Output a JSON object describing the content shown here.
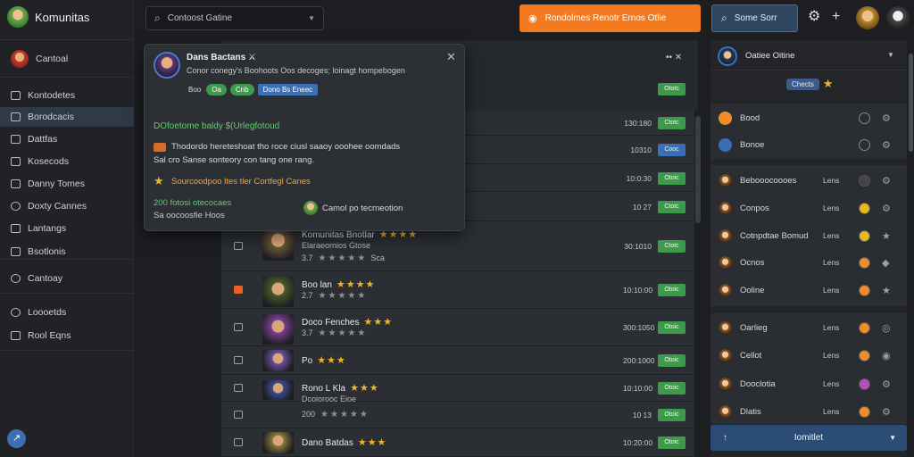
{
  "app": {
    "title": "Komunitas"
  },
  "sidebar": {
    "user_label": "Cantoal",
    "items": [
      {
        "label": "Kontodetes",
        "icon": "house-icon"
      },
      {
        "label": "Borodcacis",
        "icon": "box-icon"
      },
      {
        "label": "Dattfas",
        "icon": "folder-icon"
      },
      {
        "label": "Kosecods",
        "icon": "pin-icon"
      },
      {
        "label": "Danny Tomes",
        "icon": "doc-icon"
      },
      {
        "label": "Doxty Cannes",
        "icon": "circle-icon"
      },
      {
        "label": "Lantangs",
        "icon": "doc-icon"
      },
      {
        "label": "Bsotlonis",
        "icon": "doc-icon"
      },
      {
        "label": "Cantoay",
        "icon": "gear-icon"
      },
      {
        "label": "Loooetds",
        "icon": "circle-icon"
      },
      {
        "label": "Rool Eqns",
        "icon": "tool-icon"
      }
    ]
  },
  "topbar": {
    "search_value": "Contoost Gatine",
    "orange_label": "Rondolmes Renotr Ernos Otlie",
    "blue_label": "Some Sorr"
  },
  "popup": {
    "name": "Dans Bactans",
    "name_suffix": "⚔",
    "desc": "Conor conegy's Boohoots Oos decoges; loinagt hompebogen",
    "chips": [
      "Boo",
      "Oa",
      "Cnb",
      "Dono Bs Eneec"
    ],
    "headline": "DOfoetome baldy $(Urlegfotoud",
    "body_line1": "Thodordo hereteshoat tho roce ciusl saaoy ooohee oomdads",
    "body_line2": "Sal cro Sanse sonteory con tang one rang.",
    "star_line": "Sourcoodpoo ltes tler Cortfegl Canes",
    "green_line": "200 fotosi otecocaes",
    "grey_line": "Sa oocoosfie Hoos",
    "link_label": "Camol po tecrneotion"
  },
  "table": {
    "header_btn": "Ototc",
    "rows": [
      {
        "num": "130:180",
        "btn": "Ctotc",
        "btn_color": "#3e9a4b"
      },
      {
        "num": "10310",
        "btn": "Cooc",
        "btn_color": "#3a6fb5"
      },
      {
        "num": "10:0:30",
        "btn": "Otoic",
        "btn_color": "#3e9a4b"
      },
      {
        "num": "10 27",
        "btn": "Ctotc",
        "btn_color": "#3e9a4b"
      },
      {
        "title": "Komunitas Bnotlar",
        "sub": "Elaraeornios Gtose",
        "rating_text": "3.7",
        "extra": "Sca",
        "num": "30:1010",
        "btn": "Ctotc",
        "btn_color": "#3e9a4b",
        "stars": 4,
        "checked": false
      },
      {
        "title": "Boo lan",
        "sub": "",
        "rating_text": "2.7",
        "num": "10:10:00",
        "btn": "Otoic",
        "btn_color": "#3e9a4b",
        "stars": 4,
        "checked": true
      },
      {
        "title": "Doco Fenches",
        "sub": "",
        "rating_text": "3.7",
        "num": "300:1050",
        "btn": "Otoic",
        "btn_color": "#3e9a4b",
        "stars": 3,
        "checked": false
      },
      {
        "title": "Po",
        "sub": "",
        "rating_text": "",
        "num": "200:1000",
        "btn": "Otoic",
        "btn_color": "#3e9a4b",
        "stars": 3,
        "checked": false
      },
      {
        "title": "Rono L Kla",
        "sub": "Dcoiorooc Eioe",
        "rating_text": "",
        "num": "10:10:00",
        "btn": "Otoic",
        "btn_color": "#3e9a4b",
        "stars": 3,
        "checked": false
      },
      {
        "title": "",
        "sub": "",
        "rating_text": "200",
        "num": "10 13",
        "btn": "Otoic",
        "btn_color": "#3e9a4b",
        "stars": 0,
        "checked": false
      },
      {
        "title": "Dano Batdas",
        "sub": "",
        "rating_text": "",
        "num": "10:20:00",
        "btn": "Otoic",
        "btn_color": "#3e9a4b",
        "stars": 3,
        "checked": false
      }
    ]
  },
  "right_panel": {
    "header": "Oatiee Oitine",
    "chip": "Chects",
    "top_rows": [
      {
        "name": "Bood",
        "icon_color": "#f08c2a"
      },
      {
        "name": "Bonoe",
        "icon_color": "#3a6fb5"
      }
    ],
    "rows": [
      {
        "name": "Bebooocoooes",
        "count": "Lens",
        "b1": "#444",
        "b2": "⚙"
      },
      {
        "name": "Conpos",
        "count": "Lens",
        "b1": "#e6b91e",
        "b2": "⚙"
      },
      {
        "name": "Cotnpdtae Bomud",
        "count": "Lens",
        "b1": "#e6b91e",
        "b2": "★"
      },
      {
        "name": "Ocnos",
        "count": "Lens",
        "b1": "#f08c2a",
        "b2": "◆"
      },
      {
        "name": "Ooline",
        "count": "Lens",
        "b1": "#f08c2a",
        "b2": "★"
      },
      {
        "name": "Oarlieg",
        "count": "Lens",
        "b1": "#f08c2a",
        "b2": "◎"
      },
      {
        "name": "Cellot",
        "count": "Lens",
        "b1": "#f08c2a",
        "b2": "◉"
      },
      {
        "name": "Dooclotia",
        "count": "Lens",
        "b1": "#b84cc6",
        "b2": "⚙"
      },
      {
        "name": "Dlatis",
        "count": "Lens",
        "b1": "#f08c2a",
        "b2": "⚙"
      }
    ],
    "collapse_label": "Iomitlet"
  }
}
